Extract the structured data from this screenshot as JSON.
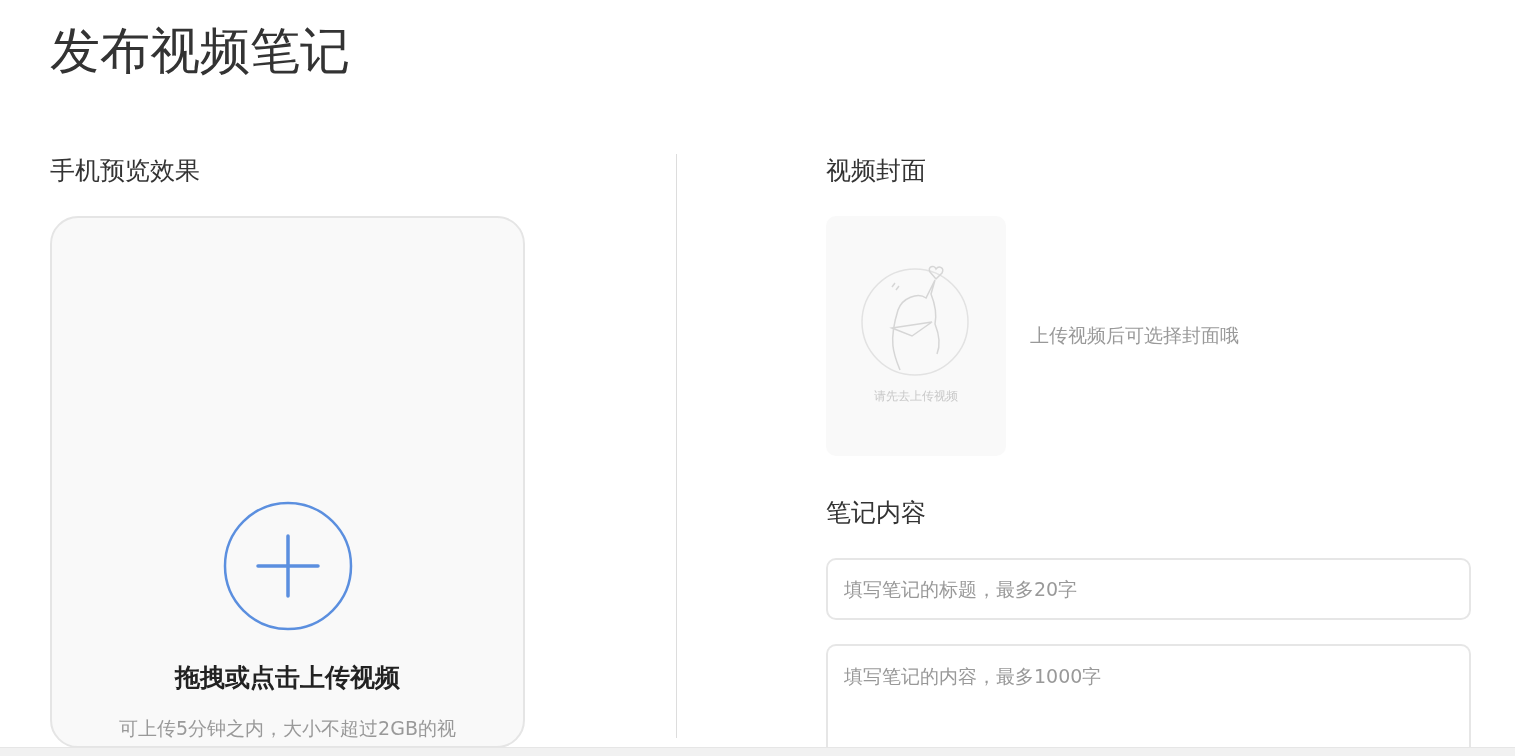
{
  "page_title": "发布视频笔记",
  "preview": {
    "heading": "手机预览效果",
    "upload_title": "拖拽或点击上传视频",
    "upload_hint": "可上传5分钟之内，大小不超过2GB的视"
  },
  "cover": {
    "heading": "视频封面",
    "placeholder_caption": "请先去上传视频",
    "hint": "上传视频后可选择封面哦"
  },
  "content": {
    "heading": "笔记内容",
    "title_field": {
      "placeholder": "填写笔记的标题，最多20字"
    },
    "body_field": {
      "placeholder": "填写笔记的内容，最多1000字"
    }
  }
}
